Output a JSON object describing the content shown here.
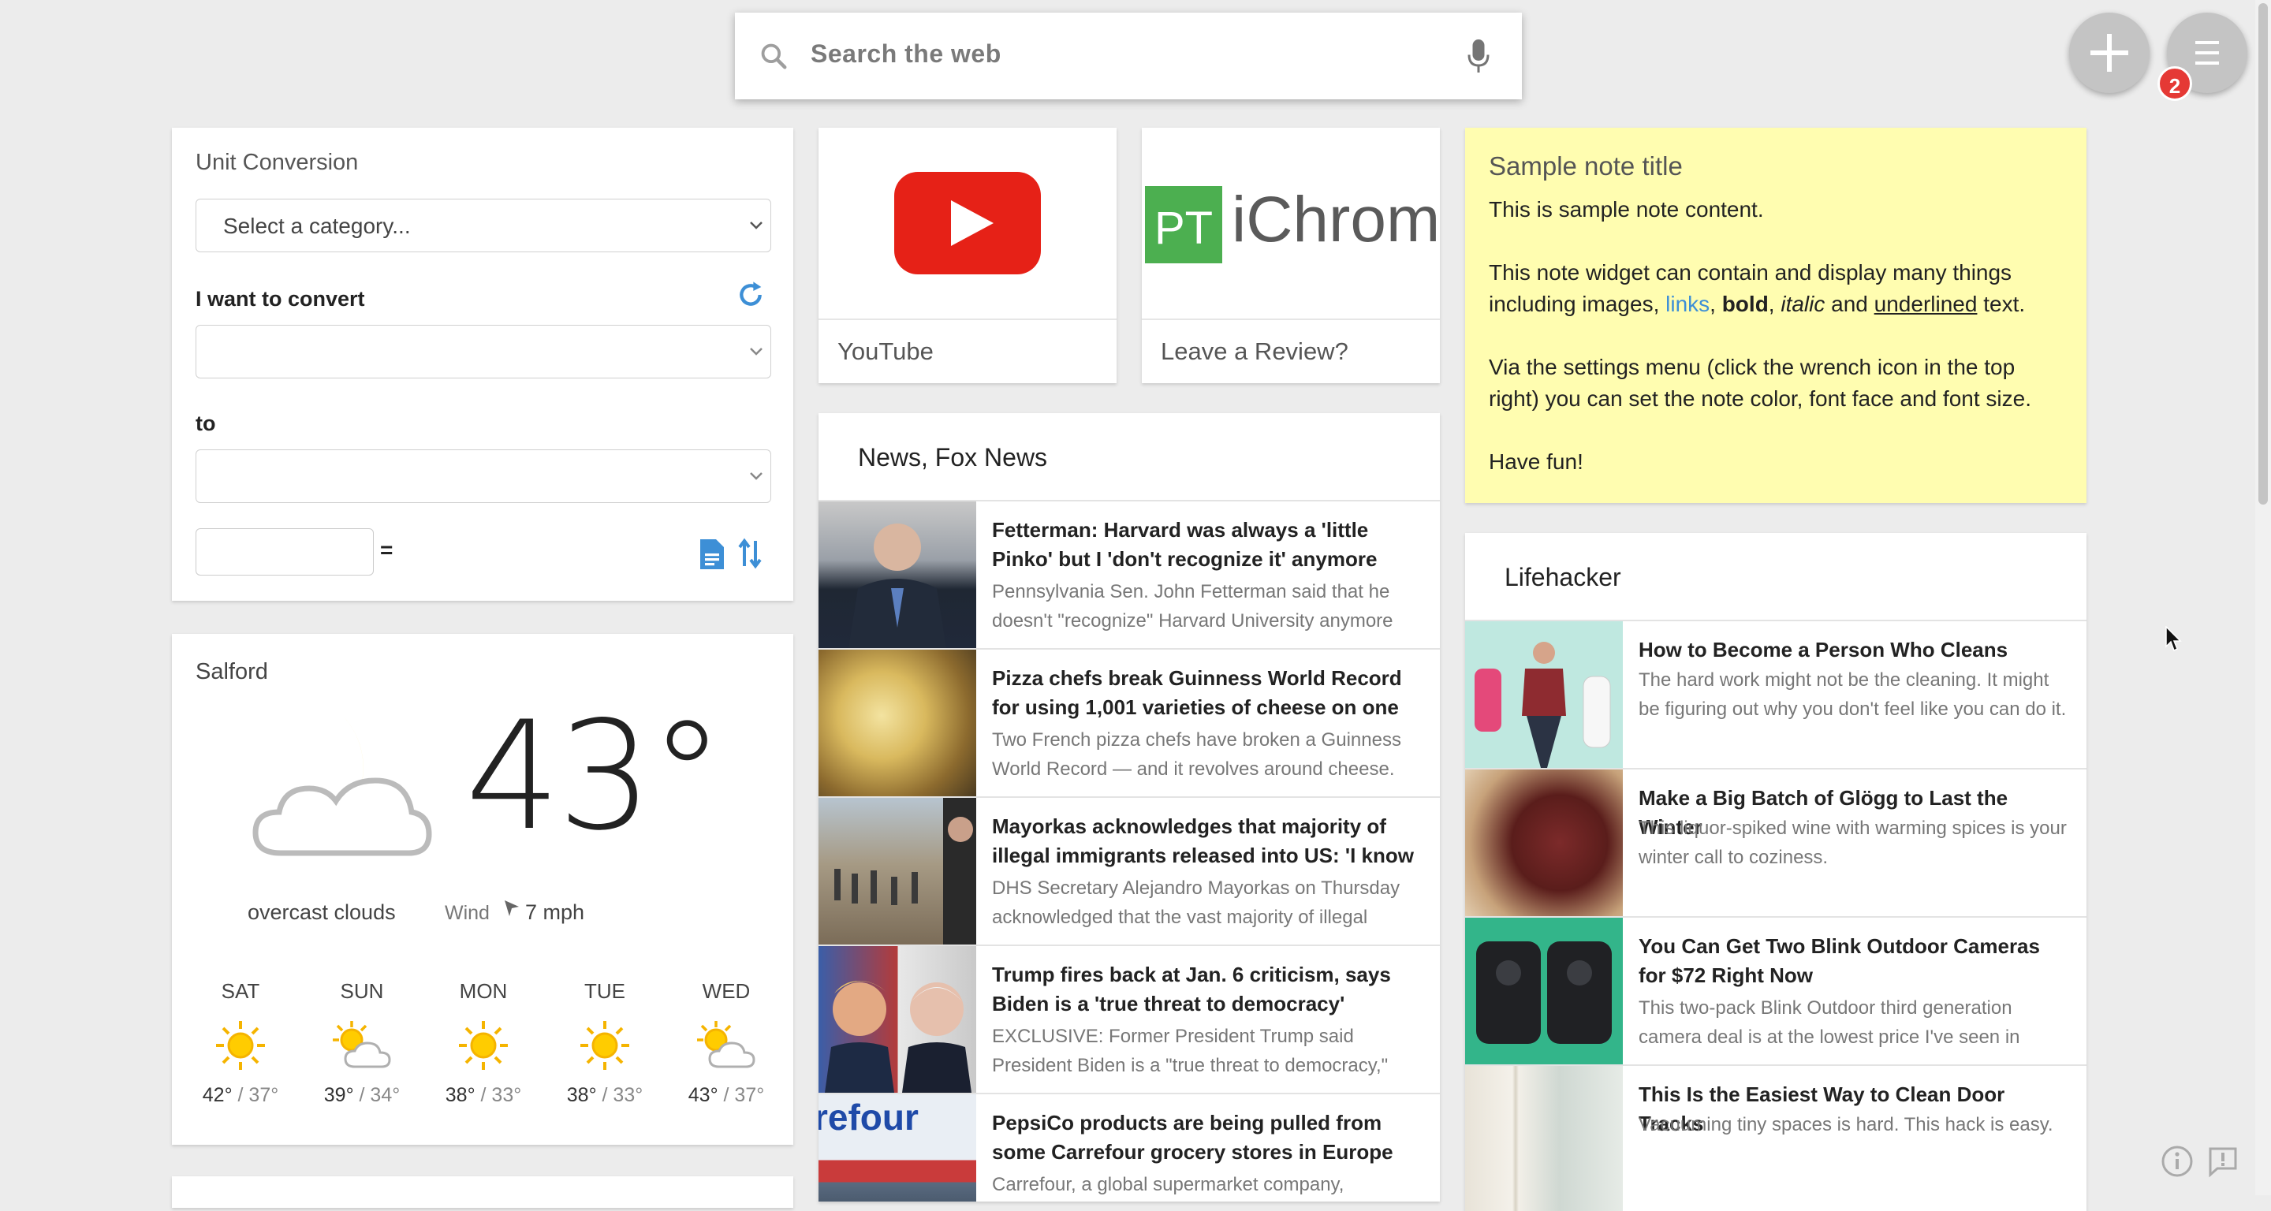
{
  "search": {
    "placeholder": "Search the web"
  },
  "menu": {
    "badge": "2"
  },
  "unit_conversion": {
    "title": "Unit Conversion",
    "category_placeholder": "Select a category...",
    "convert_label": "I want to convert",
    "to_label": "to",
    "equals": "="
  },
  "weather": {
    "city": "Salford",
    "temperature": "43°",
    "condition": "overcast clouds",
    "wind_label": "Wind",
    "wind_speed": "7 mph",
    "forecast": [
      {
        "day": "SAT",
        "high": "42°",
        "low": "37°",
        "icon": "sun-icon"
      },
      {
        "day": "SUN",
        "high": "39°",
        "low": "34°",
        "icon": "partly-cloudy-icon"
      },
      {
        "day": "MON",
        "high": "38°",
        "low": "33°",
        "icon": "sun-icon"
      },
      {
        "day": "TUE",
        "high": "38°",
        "low": "33°",
        "icon": "sun-icon"
      },
      {
        "day": "WED",
        "high": "43°",
        "low": "37°",
        "icon": "partly-cloudy-icon"
      }
    ]
  },
  "tiles": [
    {
      "label": "YouTube",
      "icon": "youtube-logo"
    },
    {
      "label": "Leave a Review?",
      "icon": "ichrome-logo",
      "logo_text": "PT",
      "logo_word": "iChrome"
    }
  ],
  "news": {
    "title": "News, Fox News",
    "items": [
      {
        "headline": "Fetterman: Harvard was always a 'little Pinko' but I 'don't recognize it' anymore",
        "summary": "Pennsylvania Sen. John Fetterman said that he doesn't \"recognize\" Harvard University anymore"
      },
      {
        "headline": "Pizza chefs break Guinness World Record for using 1,001 varieties of cheese on one Italian",
        "summary": "Two French pizza chefs have broken a Guinness World Record — and it revolves around cheese."
      },
      {
        "headline": "Mayorkas acknowledges that majority of illegal immigrants released into US: 'I know the",
        "summary": "DHS Secretary Alejandro Mayorkas on Thursday acknowledged that the vast majority of illegal"
      },
      {
        "headline": "Trump fires back at Jan. 6 criticism, says Biden is a 'true threat to democracy'",
        "summary": "EXCLUSIVE: Former President Trump said President Biden is a \"true threat to democracy,\""
      },
      {
        "headline": "PepsiCo products are being pulled from some Carrefour grocery stores in Europe over price",
        "summary": "Carrefour, a global supermarket company,",
        "thumb_text": "refour"
      }
    ]
  },
  "note": {
    "title": "Sample note title",
    "line1": "This is sample note content.",
    "line2a": "This note widget can contain and display many things",
    "line2b_pre": "including images, ",
    "link": "links",
    "comma1": ", ",
    "bold": "bold",
    "comma2": ", ",
    "italic": "italic",
    "and": " and ",
    "underlined": "underlined",
    "text_end": " text.",
    "line3a": "Via the settings menu (click the wrench icon in the top",
    "line3b": "right) you can set the note color, font face and font size.",
    "line4": "Have fun!"
  },
  "lifehacker": {
    "title": "Lifehacker",
    "items": [
      {
        "headline": "How to Become a Person Who Cleans",
        "summary": "The hard work might not be the cleaning. It might be figuring out why you don't feel like you can do it."
      },
      {
        "headline": "Make a Big Batch of Glögg to Last the Winter",
        "summary": "This liquor-spiked wine with warming spices is your winter call to coziness."
      },
      {
        "headline": "You Can Get Two Blink Outdoor Cameras for $72 Right Now",
        "summary": "This two-pack Blink Outdoor third generation camera deal is at the lowest price I've seen in"
      },
      {
        "headline": "This Is the Easiest Way to Clean Door Tracks",
        "summary": "Vacuuming tiny spaces is hard. This hack is easy."
      }
    ]
  },
  "colors": {
    "accent": "#3d8fd6",
    "youtube_red": "#e62117",
    "ichrome_green": "#4caf50",
    "note_bg": "#fffdb0",
    "badge": "#e53935"
  }
}
